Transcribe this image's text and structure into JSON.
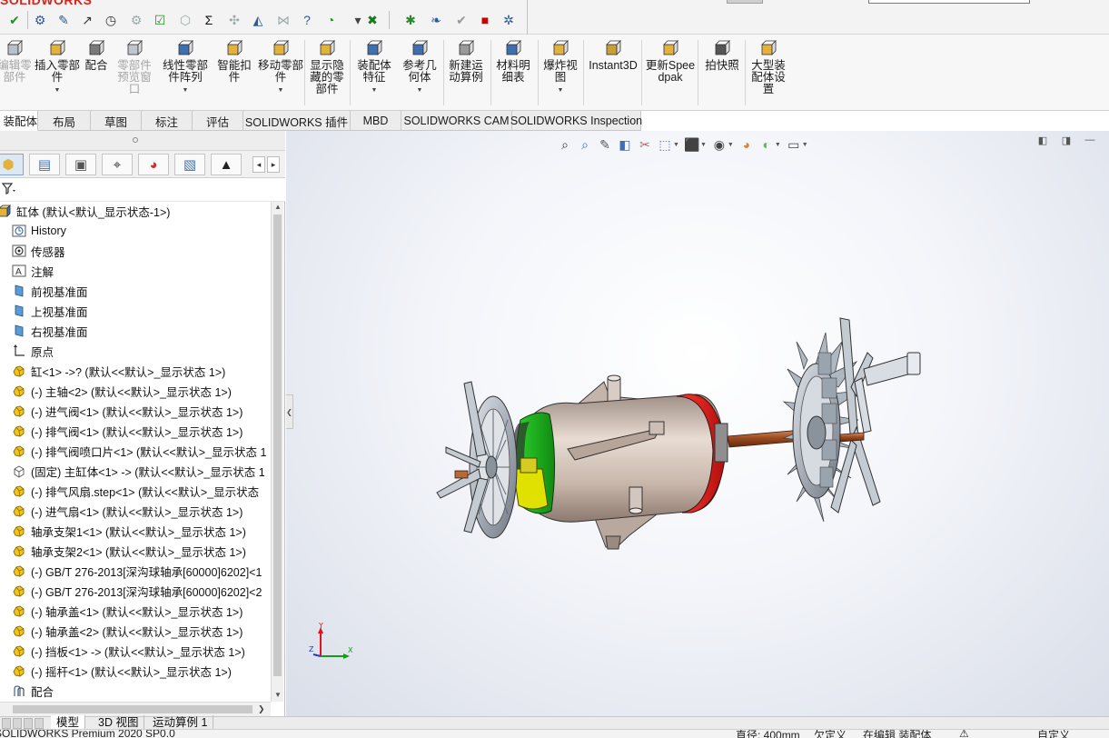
{
  "app": {
    "brand": "SOLIDWORKS"
  },
  "ribbon": {
    "buttons": [
      {
        "label": "编辑零部件",
        "enabled": false
      },
      {
        "label": "插入零部件",
        "enabled": true
      },
      {
        "label": "配合",
        "enabled": true
      },
      {
        "label": "零部件预览窗口",
        "enabled": false
      },
      {
        "label": "线性零部件阵列",
        "enabled": true
      },
      {
        "label": "智能扣件",
        "enabled": true
      },
      {
        "label": "移动零部件",
        "enabled": true
      },
      {
        "label": "显示隐藏的零部件",
        "enabled": true
      },
      {
        "label": "装配体特征",
        "enabled": true
      },
      {
        "label": "参考几何体",
        "enabled": true
      },
      {
        "label": "新建运动算例",
        "enabled": true
      },
      {
        "label": "材料明细表",
        "enabled": true
      },
      {
        "label": "爆炸视图",
        "enabled": true
      },
      {
        "label": "Instant3D",
        "enabled": true
      },
      {
        "label": "更新Speedpak",
        "enabled": true
      },
      {
        "label": "拍快照",
        "enabled": true
      },
      {
        "label": "大型装配体设置",
        "enabled": true
      }
    ]
  },
  "command_tabs": [
    "装配体",
    "布局",
    "草图",
    "标注",
    "评估",
    "SOLIDWORKS 插件",
    "MBD",
    "SOLIDWORKS CAM",
    "SOLIDWORKS Inspection"
  ],
  "tree": {
    "root": "缸体  (默认<默认_显示状态-1>)",
    "items": [
      {
        "label": "History",
        "icon": "history-icon"
      },
      {
        "label": "传感器",
        "icon": "sensor-icon"
      },
      {
        "label": "注解",
        "icon": "annotation-icon"
      },
      {
        "label": "前视基准面",
        "icon": "plane-icon"
      },
      {
        "label": "上视基准面",
        "icon": "plane-icon"
      },
      {
        "label": "右视基准面",
        "icon": "plane-icon"
      },
      {
        "label": "原点",
        "icon": "origin-icon"
      },
      {
        "label": "缸<1> ->? (默认<<默认>_显示状态 1>)",
        "icon": "part-icon"
      },
      {
        "label": "(-) 主轴<2> (默认<<默认>_显示状态 1>)",
        "icon": "part-icon"
      },
      {
        "label": "(-) 进气阀<1> (默认<<默认>_显示状态 1>)",
        "icon": "part-icon"
      },
      {
        "label": "(-) 排气阀<1> (默认<<默认>_显示状态 1>)",
        "icon": "part-icon"
      },
      {
        "label": "(-) 排气阀喷口片<1> (默认<<默认>_显示状态 1",
        "icon": "part-icon"
      },
      {
        "label": "(固定) 主缸体<1> -> (默认<<默认>_显示状态 1",
        "icon": "fixed-part-icon"
      },
      {
        "label": "(-) 排气风扇.step<1> (默认<<默认>_显示状态",
        "icon": "part-icon"
      },
      {
        "label": "(-) 进气扇<1> (默认<<默认>_显示状态 1>)",
        "icon": "part-icon"
      },
      {
        "label": "轴承支架1<1> (默认<<默认>_显示状态 1>)",
        "icon": "part-icon"
      },
      {
        "label": "轴承支架2<1> (默认<<默认>_显示状态 1>)",
        "icon": "part-icon"
      },
      {
        "label": "(-) GB/T 276-2013[深沟球轴承[60000]6202]<1",
        "icon": "part-icon"
      },
      {
        "label": "(-) GB/T 276-2013[深沟球轴承[60000]6202]<2",
        "icon": "part-icon"
      },
      {
        "label": "(-) 轴承盖<1> (默认<<默认>_显示状态 1>)",
        "icon": "part-icon"
      },
      {
        "label": "(-) 轴承盖<2> (默认<<默认>_显示状态 1>)",
        "icon": "part-icon"
      },
      {
        "label": "(-) 挡板<1> -> (默认<<默认>_显示状态 1>)",
        "icon": "part-icon"
      },
      {
        "label": "(-) 摇杆<1> (默认<<默认>_显示状态 1>)",
        "icon": "part-icon"
      },
      {
        "label": "配合",
        "icon": "mates-icon"
      }
    ]
  },
  "bottom_tabs": [
    "模型",
    "3D 视图",
    "运动算例 1"
  ],
  "status": {
    "left": "SOLIDWORKS Premium 2020 SP0.0",
    "items": [
      "直径: 400mm",
      "欠定义",
      "在编辑 装配体",
      "自定义"
    ]
  },
  "triad": {
    "x": "X",
    "y": "Y",
    "z": "Z"
  },
  "colors": {
    "accent": "#2a5b9c",
    "brand": "#d4261d",
    "band_green": "#21a121",
    "band_red": "#e31a1a",
    "band_yellow": "#e1e100"
  }
}
